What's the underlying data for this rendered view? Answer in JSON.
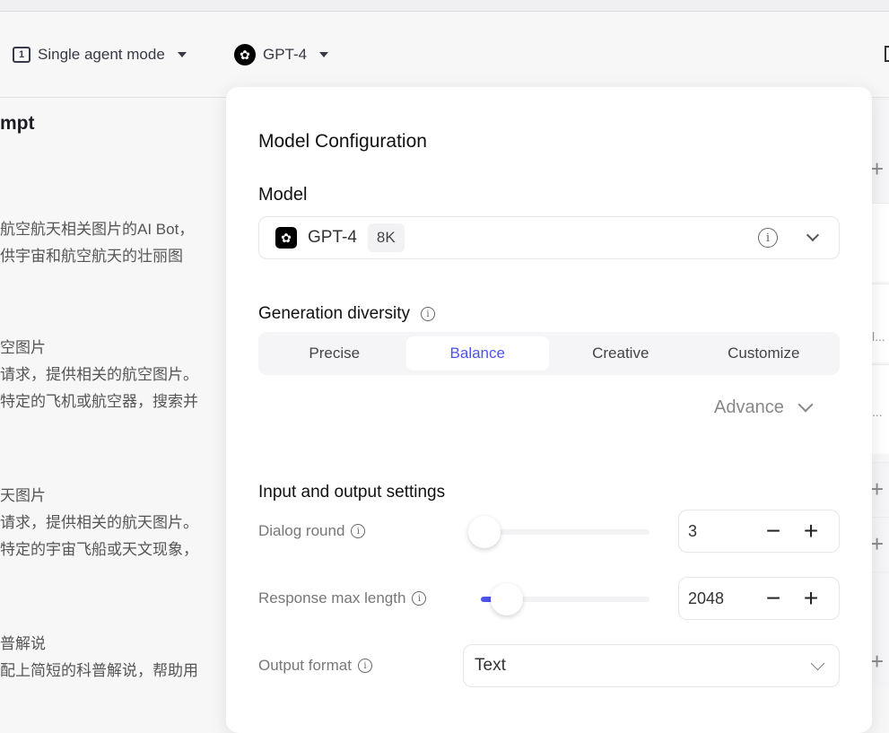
{
  "header": {
    "mode_label": "Single agent mode",
    "model_label": "GPT-4"
  },
  "left": {
    "section_title": "mpt",
    "lines": [
      "航空航天相关图片的AI Bot，",
      "供宇宙和航空航天的壮丽图"
    ],
    "skill1": {
      "title": "空图片",
      "lines": [
        "请求，提供相关的航空图片。",
        "特定的飞机或航空器，搜索并"
      ]
    },
    "skill2": {
      "title": "天图片",
      "lines": [
        "请求，提供相关的航天图片。",
        "特定的宇宙飞船或天文现象，"
      ]
    },
    "skill3": {
      "title": "普解说",
      "lines": [
        "配上简短的科普解说，帮助用"
      ]
    }
  },
  "right_strip": {
    "truncated1": "l...",
    "truncated2": "..."
  },
  "panel": {
    "title": "Model Configuration",
    "model_heading": "Model",
    "model": {
      "name": "GPT-4",
      "context": "8K"
    },
    "diversity": {
      "label": "Generation diversity",
      "options": [
        "Precise",
        "Balance",
        "Creative",
        "Customize"
      ],
      "selected": "Balance"
    },
    "advance_label": "Advance",
    "io": {
      "title": "Input and output settings",
      "dialog_round": {
        "label": "Dialog round",
        "value": "3",
        "slider_level": 0.0
      },
      "response_max_length": {
        "label": "Response max length",
        "value": "2048",
        "slider_level": 0.25
      },
      "output_format": {
        "label": "Output format",
        "value": "Text"
      }
    }
  },
  "colors": {
    "accent": "#4d53e8"
  }
}
